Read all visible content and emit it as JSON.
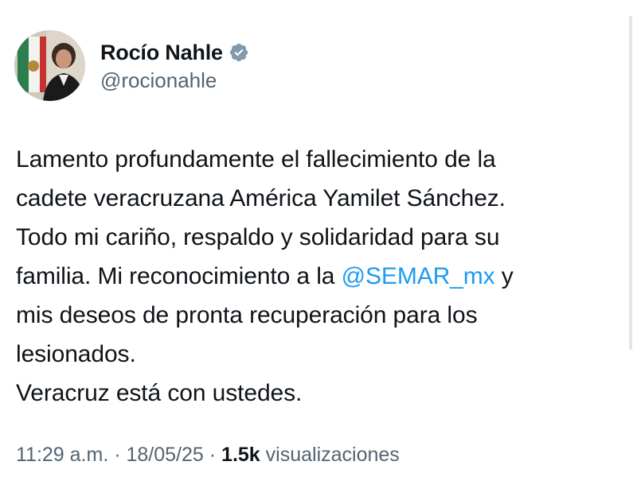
{
  "author": {
    "display_name": "Rocío Nahle",
    "handle": "@rocionahle",
    "verified": true
  },
  "tweet": {
    "line1": "Lamento profundamente el fallecimiento de la",
    "line2": "cadete veracruzana América Yamilet Sánchez.",
    "line3": "Todo mi cariño, respaldo y solidaridad para su",
    "line4_before": "familia. Mi reconocimiento a la ",
    "mention": "@SEMAR_mx",
    "line4_after": " y",
    "line5": "mis deseos de pronta recuperación para los",
    "line6": "lesionados.",
    "line7": "Veracruz está con ustedes."
  },
  "meta": {
    "time": "11:29 a.m.",
    "sep1": " · ",
    "date": "18/05/25",
    "sep2": " · ",
    "views_count": "1.5k",
    "views_label": " visualizaciones"
  },
  "colors": {
    "text": "#0f1419",
    "secondary": "#536471",
    "link": "#1d9bf0",
    "verified": "#829aab"
  }
}
